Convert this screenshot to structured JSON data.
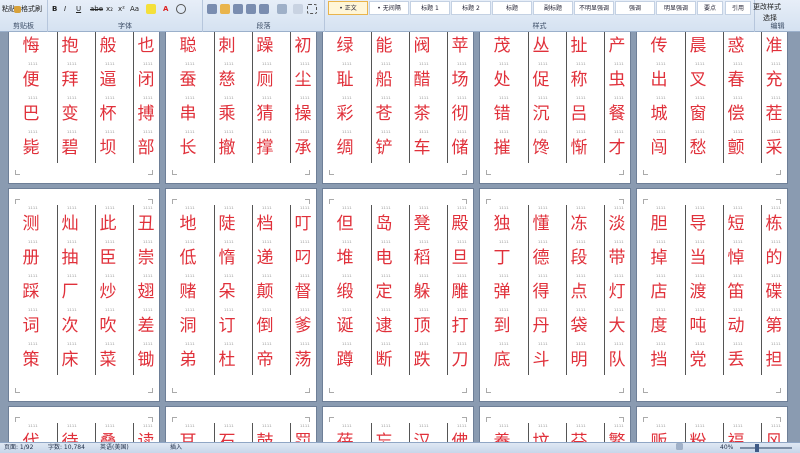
{
  "ribbon": {
    "clipboard": {
      "paste": "粘贴",
      "format_painter": "格式刷",
      "label": "剪贴板"
    },
    "font": {
      "label": "字体",
      "bold": "B",
      "italic": "I",
      "underline": "U",
      "strike": "abe",
      "sub": "x₂",
      "sup": "x²",
      "case": "Aa",
      "color": "A"
    },
    "paragraph": {
      "label": "段落"
    },
    "styles": {
      "label": "样式",
      "items": [
        "• 正文",
        "• 无间隔",
        "标题 1",
        "标题 2",
        "标题",
        "副标题",
        "不明显强调",
        "强调",
        "明显强调",
        "要点",
        "引用"
      ],
      "change": "更改样式"
    },
    "editing": {
      "label": "编辑",
      "select": "选择"
    }
  },
  "pages_row1": [
    [
      [
        "悔",
        "便",
        "巴",
        "毙"
      ],
      [
        "抱",
        "拜",
        "变",
        "碧"
      ],
      [
        "般",
        "逼",
        "杯",
        "坝"
      ],
      [
        "也",
        "闭",
        "搏",
        "部"
      ]
    ],
    [
      [
        "聪",
        "蚕",
        "串",
        "长"
      ],
      [
        "刺",
        "慈",
        "乘",
        "撤"
      ],
      [
        "躁",
        "厕",
        "猜",
        "撑"
      ],
      [
        "初",
        "尘",
        "操",
        "承"
      ]
    ],
    [
      [
        "绿",
        "耻",
        "彩",
        "绸"
      ],
      [
        "能",
        "船",
        "苍",
        "铲"
      ],
      [
        "阀",
        "醋",
        "茶",
        "车"
      ],
      [
        "苹",
        "场",
        "彻",
        "储"
      ]
    ],
    [
      [
        "茂",
        "处",
        "错",
        "摧"
      ],
      [
        "丛",
        "促",
        "沉",
        "馋"
      ],
      [
        "扯",
        "称",
        "吕",
        "惭"
      ],
      [
        "产",
        "虫",
        "餐",
        "才"
      ]
    ],
    [
      [
        "传",
        "出",
        "城",
        "闯"
      ],
      [
        "晨",
        "叉",
        "窗",
        "愁"
      ],
      [
        "惑",
        "春",
        "偿",
        "颤"
      ],
      [
        "准",
        "充",
        "茬",
        "采"
      ]
    ]
  ],
  "pages_row2": [
    [
      [
        "测",
        "册",
        "踩",
        "词",
        "策"
      ],
      [
        "灿",
        "抽",
        "厂",
        "次",
        "床"
      ],
      [
        "此",
        "臣",
        "炒",
        "吹",
        "菜"
      ],
      [
        "丑",
        "崇",
        "翅",
        "差",
        "锄"
      ]
    ],
    [
      [
        "地",
        "低",
        "赌",
        "洞",
        "弟"
      ],
      [
        "陡",
        "惰",
        "朵",
        "订",
        "杜"
      ],
      [
        "档",
        "递",
        "颠",
        "倒",
        "帝"
      ],
      [
        "叮",
        "叼",
        "督",
        "爹",
        "荡"
      ]
    ],
    [
      [
        "但",
        "堆",
        "缎",
        "诞",
        "蹲"
      ],
      [
        "岛",
        "电",
        "定",
        "逮",
        "断"
      ],
      [
        "凳",
        "稻",
        "躲",
        "顶",
        "跌"
      ],
      [
        "殿",
        "旦",
        "雕",
        "打",
        "刀"
      ]
    ],
    [
      [
        "独",
        "丁",
        "弹",
        "到",
        "底"
      ],
      [
        "懂",
        "德",
        "得",
        "丹",
        "斗"
      ],
      [
        "冻",
        "段",
        "点",
        "袋",
        "明"
      ],
      [
        "淡",
        "带",
        "灯",
        "大",
        "队"
      ]
    ],
    [
      [
        "胆",
        "掉",
        "店",
        "度",
        "挡"
      ],
      [
        "导",
        "当",
        "渡",
        "吨",
        "党"
      ],
      [
        "短",
        "悼",
        "笛",
        "动",
        "丢"
      ],
      [
        "栋",
        "的",
        "碟",
        "第",
        "担"
      ]
    ]
  ],
  "pages_row3": [
    [
      [
        "代"
      ],
      [
        "待"
      ],
      [
        "叠"
      ],
      [
        "读"
      ]
    ],
    [
      [
        "耳"
      ],
      [
        "石"
      ],
      [
        "鼓"
      ],
      [
        "罚"
      ]
    ],
    [
      [
        "蓓"
      ],
      [
        "忘"
      ],
      [
        "汉"
      ],
      [
        "佛"
      ]
    ],
    [
      [
        "養"
      ],
      [
        "坟"
      ],
      [
        "芬"
      ],
      [
        "繁"
      ]
    ],
    [
      [
        "贩"
      ],
      [
        "粉"
      ],
      [
        "福"
      ],
      [
        "风"
      ]
    ]
  ],
  "status": {
    "page": "页面: 1/92",
    "words": "字数: 10,784",
    "lang": "英语(美国)",
    "mode": "插入",
    "zoom": "40%"
  }
}
